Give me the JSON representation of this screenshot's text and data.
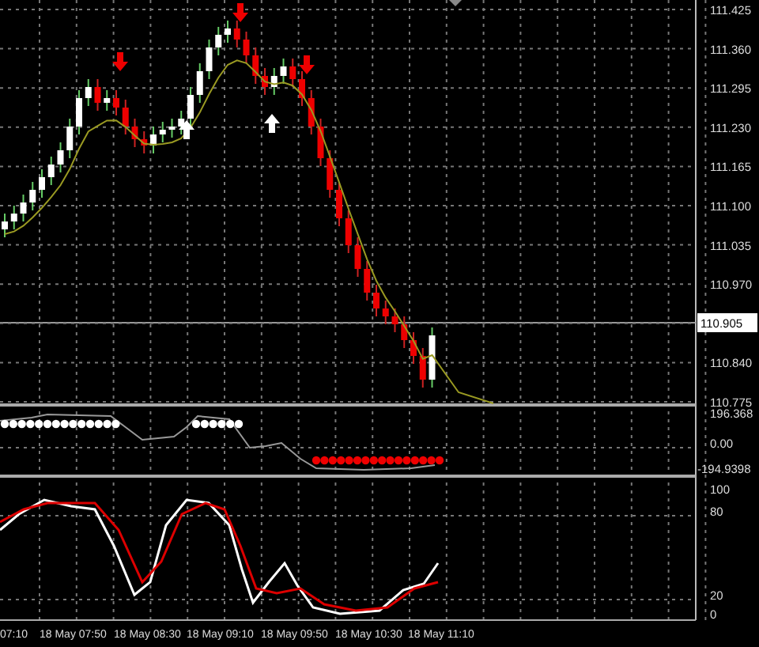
{
  "price_axis": {
    "labels": [
      "111.425",
      "111.360",
      "111.295",
      "111.230",
      "111.165",
      "111.100",
      "111.035",
      "110.970",
      "110.840",
      "110.775"
    ],
    "current_price": "110.905"
  },
  "cci_axis": {
    "labels": [
      "196.368",
      "0.00",
      "-194.9398"
    ]
  },
  "stochastic_axis": {
    "labels": [
      "100",
      "80",
      "20",
      "0"
    ]
  },
  "time_axis": {
    "labels": [
      "07:10",
      "18 May 07:50",
      "18 May 08:30",
      "18 May 09:10",
      "18 May 09:50",
      "18 May 10:30",
      "18 May 11:10"
    ]
  }
}
